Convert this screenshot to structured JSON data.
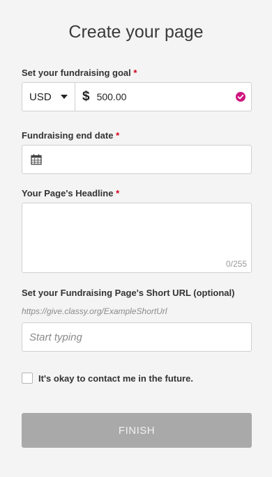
{
  "page": {
    "title": "Create your page"
  },
  "goal": {
    "label": "Set your fundraising goal",
    "required_mark": "*",
    "currency": "USD",
    "currency_symbol": "$",
    "amount": "500.00",
    "valid_icon": "check-circle-icon",
    "valid_color": "#d0157f"
  },
  "end_date": {
    "label": "Fundraising end date",
    "required_mark": "*",
    "icon": "calendar-icon",
    "value": ""
  },
  "headline": {
    "label": "Your Page's Headline",
    "required_mark": "*",
    "value": "",
    "counter": "0/255"
  },
  "short_url": {
    "label": "Set your Fundraising Page's Short URL (optional)",
    "example": "https://give.classy.org/ExampleShortUrl",
    "placeholder": "Start typing",
    "value": ""
  },
  "contact": {
    "label": "It's okay to contact me in the future.",
    "checked": false
  },
  "finish": {
    "label": "FINISH",
    "color": "#a9a9a9"
  }
}
